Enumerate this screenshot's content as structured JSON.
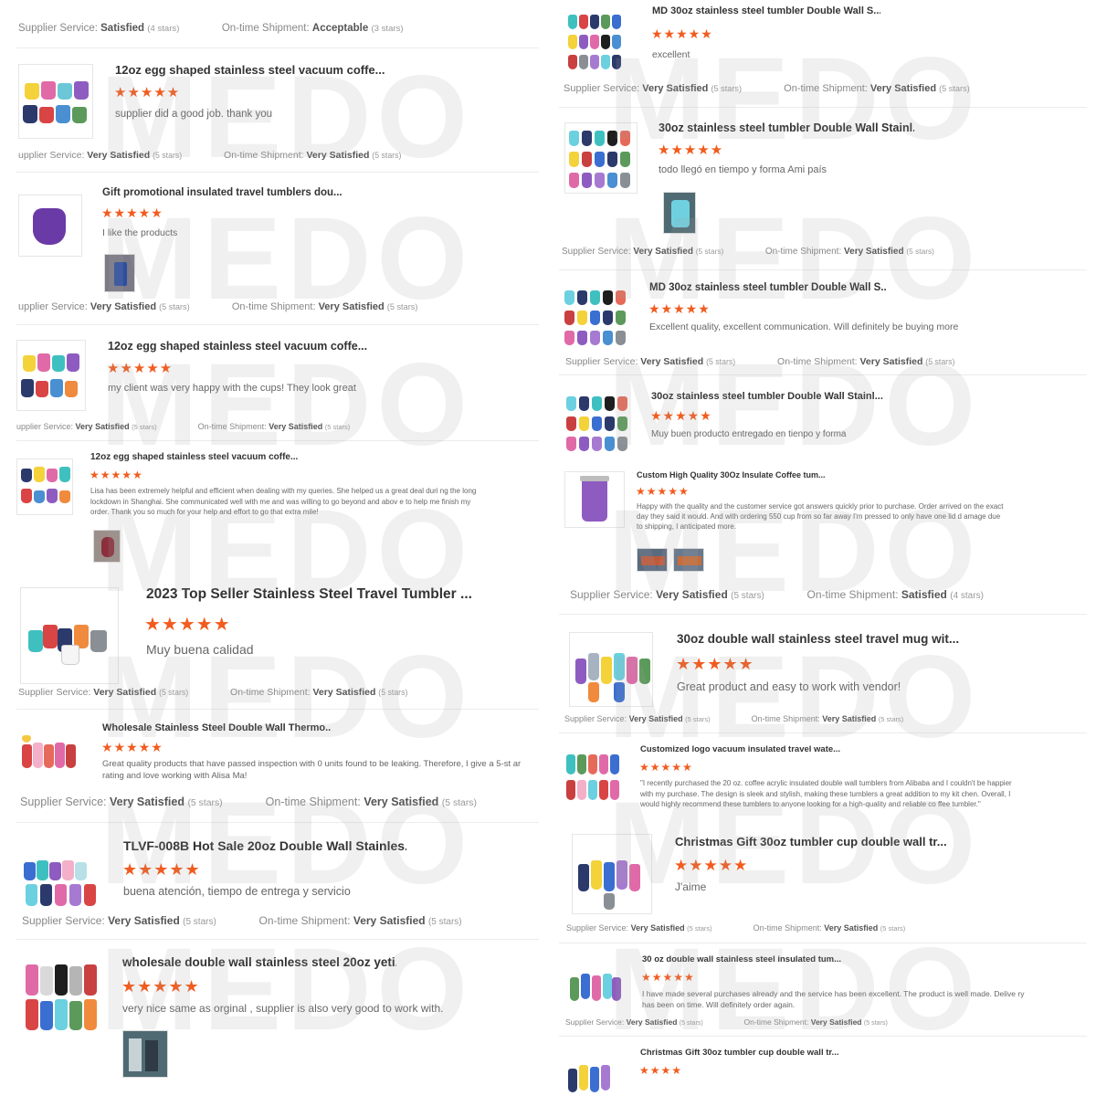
{
  "watermark": "MEDO",
  "colors": {
    "star": "#f25b1e",
    "title": "#333333",
    "text": "#666666"
  },
  "left_column": {
    "top_ratings": {
      "service_label": "Supplier Service:",
      "service_value": "Satisfied",
      "service_stars": "(4 stars)",
      "shipment_label": "On-time Shipment:",
      "shipment_value": "Acceptable",
      "shipment_stars": "(3 stars)"
    },
    "reviews": [
      {
        "title": "12oz egg shaped stainless steel vacuum coffe...",
        "stars": "★★★★★",
        "comment": "supplier did a good job. thank you",
        "service_label": "upplier Service:",
        "service_value": "Very Satisfied",
        "service_stars": "(5 stars)",
        "shipment_label": "On-time Shipment:",
        "shipment_value": "Very Satisfied",
        "shipment_stars": "(5 stars)"
      },
      {
        "title": "Gift promotional insulated travel tumblers dou...",
        "stars": "★★★★★",
        "comment": "I like the products",
        "service_label": "upplier Service:",
        "service_value": "Very Satisfied",
        "service_stars": "(5 stars)",
        "shipment_label": "On-time Shipment:",
        "shipment_value": "Very Satisfied",
        "shipment_stars": "(5 stars)"
      },
      {
        "title": "12oz egg shaped stainless steel vacuum coffe...",
        "stars": "★★★★★",
        "comment": "my client was very happy with the cups! They look great",
        "service_label": "upplier Service:",
        "service_value": "Very Satisfied",
        "service_stars": "(5 stars)",
        "shipment_label": "On-time Shipment:",
        "shipment_value": "Very Satisfied",
        "shipment_stars": "(5 stars)"
      },
      {
        "title": "12oz egg shaped stainless steel vacuum coffe...",
        "stars": "★★★★★",
        "comment": "Lisa has been extremely helpful and efficient when dealing with my queries. She helped us a great deal duri ng the long lockdown in Shanghai. She communicated well with me and was willing to go beyond and abov e to help me finish my order. Thank you so much for your help and effort to go that extra mile!"
      },
      {
        "title": "2023 Top Seller Stainless Steel Travel Tumbler ...",
        "stars": "★★★★★",
        "comment": "Muy buena calidad",
        "service_label": "Supplier Service:",
        "service_value": "Very Satisfied",
        "service_stars": "(5 stars)",
        "shipment_label": "On-time Shipment:",
        "shipment_value": "Very Satisfied",
        "shipment_stars": "(5 stars)"
      },
      {
        "title": "Wholesale Stainless Steel Double Wall Thermo...",
        "stars": "★★★★★",
        "comment": "Great quality products that have passed inspection with 0 units found to be leaking. Therefore, I give a 5-st ar rating and love working with Alisa Ma!",
        "service_label": "Supplier Service:",
        "service_value": "Very Satisfied",
        "service_stars": "(5 stars)",
        "shipment_label": "On-time Shipment:",
        "shipment_value": "Very Satisfied",
        "shipment_stars": "(5 stars)"
      },
      {
        "title": "TLVF-008B Hot Sale 20oz Double Wall Stainles...",
        "stars": "★★★★★",
        "comment": "buena atención, tiempo de entrega y servicio",
        "service_label": "Supplier Service:",
        "service_value": "Very Satisfied",
        "service_stars": "(5 stars)",
        "shipment_label": "On-time Shipment:",
        "shipment_value": "Very Satisfied",
        "shipment_stars": "(5 stars)"
      },
      {
        "title": "wholesale double wall stainless steel 20oz yeti...",
        "stars": "★★★★★",
        "comment": "very nice same as orginal , supplier is also very good to work with."
      }
    ]
  },
  "right_column": {
    "reviews": [
      {
        "title": "MD 30oz stainless steel tumbler Double Wall S...",
        "stars": "★★★★★",
        "comment": "excellent",
        "service_label": "Supplier Service:",
        "service_value": "Very Satisfied",
        "service_stars": "(5 stars)",
        "shipment_label": "On-time Shipment:",
        "shipment_value": "Very Satisfied",
        "shipment_stars": "(5 stars)"
      },
      {
        "title": "30oz stainless steel tumbler Double Wall Stainl...",
        "stars": "★★★★★",
        "comment": "todo llegó en tiempo y forma Ami país",
        "service_label": "Supplier Service:",
        "service_value": "Very Satisfied",
        "service_stars": "(5 stars)",
        "shipment_label": "On-time Shipment:",
        "shipment_value": "Very Satisfied",
        "shipment_stars": "(5 stars)"
      },
      {
        "title": "MD 30oz stainless steel tumbler Double Wall S...",
        "stars": "★★★★★",
        "comment": "Excellent quality, excellent communication. Will definitely be buying more",
        "service_label": "Supplier Service:",
        "service_value": "Very Satisfied",
        "service_stars": "(5 stars)",
        "shipment_label": "On-time Shipment:",
        "shipment_value": "Very Satisfied",
        "shipment_stars": "(5 stars)"
      },
      {
        "title": "30oz stainless steel tumbler Double Wall Stainl...",
        "stars": "★★★★★",
        "comment": "Muy buen producto entregado en tienpo y forma"
      },
      {
        "title": "Custom High Quality 30Oz Insulate Coffee tum...",
        "stars": "★★★★★",
        "comment": "Happy with the quality and the customer service got answers quickly prior to purchase. Order arrived on the exact day they said it would. And with ordering 550 cup from so far away I'm pressed to only have one lid d amage due to shipping, I anticipated more.",
        "service_label": "Supplier Service:",
        "service_value": "Very Satisfied",
        "service_stars": "(5 stars)",
        "shipment_label": "On-time Shipment:",
        "shipment_value": "Satisfied",
        "shipment_stars": "(4 stars)"
      },
      {
        "title": "30oz double wall stainless steel travel mug wit...",
        "stars": "★★★★★",
        "comment": "Great product and easy to work with vendor!",
        "service_label": "Supplier Service:",
        "service_value": "Very Satisfied",
        "service_stars": "(5 stars)",
        "shipment_label": "On-time Shipment:",
        "shipment_value": "Very Satisfied",
        "shipment_stars": "(5 stars)"
      },
      {
        "title": "Customized logo vacuum insulated travel wate...",
        "stars": "★★★★★",
        "comment": "\"I recently purchased the 20 oz. coffee acrylic insulated double wall tumblers from Alibaba and I couldn't be happier with my purchase. The design is sleek and stylish, making these tumblers a great addition to my kit chen. Overall, I would highly recommend these tumblers to anyone looking for a high-quality and reliable co ffee tumbler.\""
      },
      {
        "title": "Christmas Gift 30oz tumbler cup double wall tr...",
        "stars": "★★★★★",
        "comment": "J'aime",
        "service_label": "Supplier Service:",
        "service_value": "Very Satisfied",
        "service_stars": "(5 stars)",
        "shipment_label": "On-time Shipment:",
        "shipment_value": "Very Satisfied",
        "shipment_stars": "(5 stars)"
      },
      {
        "title": "30 oz double wall stainless steel insulated tum...",
        "stars": "★★★★★",
        "comment": "I have made several purchases already and the service has been excellent. The product is well made. Delive ry has been on time. Will definitely order again.",
        "service_label": "Supplier Service:",
        "service_value": "Very Satisfied",
        "service_stars": "(5 stars)",
        "shipment_label": "On-time Shipment:",
        "shipment_value": "Very Satisfied",
        "shipment_stars": "(5 stars)"
      },
      {
        "title": "Christmas Gift 30oz tumbler cup double wall tr...",
        "stars": "★★★★"
      }
    ]
  }
}
